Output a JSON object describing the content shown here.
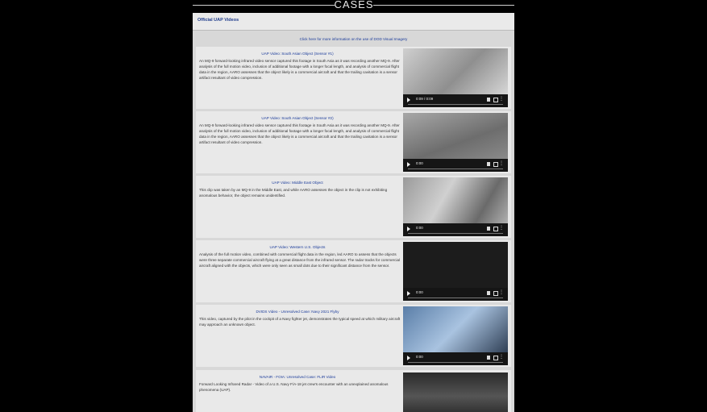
{
  "header": {
    "title": "CASES"
  },
  "panel": {
    "title": "Official UAP Videos",
    "click_link": "Click here for more information on the use of DOD Visual Imagery"
  },
  "videos": [
    {
      "title": "UAP Video: South Asian Object (Sensor #1)",
      "desc": "An MQ-9 forward-looking infrared video sensor captured this footage in South Asia as it was recording another MQ-9. After analysis of the full motion video, inclusion of additional footage with a longer focal length, and analysis of commercial flight data in the region, AARO assesses that the object likely is a commercial aircraft and that the trailing cavitation is a sensor artifact resultant of video compression.",
      "time": "0:09 / 0:09"
    },
    {
      "title": "UAP Video: South Asian Object (Sensor #2)",
      "desc": "An MQ-9 forward-looking infrared video sensor captured this footage in South Asia as it was recording another MQ-9. After analysis of the full motion video, inclusion of additional footage with a longer focal length, and analysis of commercial flight data in the region, AARO assesses that the object likely is a commercial aircraft and that the trailing cavitation is a sensor artifact resultant of video compression.",
      "time": "0:00"
    },
    {
      "title": "UAP Video: Middle East Object",
      "desc": "This clip was taken by an MQ-9 in the Middle East, and while AARO assesses the object in the clip is not exhibiting anomalous behavior, the object remains unidentified.",
      "time": "0:00"
    },
    {
      "title": "UAP Video: Western U.S. Objects",
      "desc": "Analysis of the full motion video, combined with commercial flight data in the region, led AARO to assess that the objects were three separate commercial aircraft flying at a great distance from the infrared sensor. The radar tracks for commercial aircraft aligned with the objects, which were only seen as small dots due to their significant distance from the sensor.",
      "time": "0:00"
    },
    {
      "title": "DVIDS Video - Unresolved Case: Navy 2021 Flyby",
      "desc": "This video, captured by the pilot in the cockpit of a Navy fighter jet, demonstrates the typical speed at which military aircraft may approach an unknown object.",
      "time": "0:00"
    },
    {
      "title": "NAVAIR - FOIA: Unresolved Case: FLIR Video",
      "desc": "Forward Looking Infrared Radar - Video of a U.S. Navy F/A-18 jet crew's encounter with an unexplained anomalous phenomena (UAP).",
      "time": ""
    }
  ],
  "colors": {
    "link": "#1a3b9a",
    "panel_bg": "#d8d8d8",
    "row_bg": "#e9e9e9"
  },
  "icons": [
    "play-icon",
    "volume-icon",
    "fullscreen-icon",
    "more-options-icon"
  ]
}
